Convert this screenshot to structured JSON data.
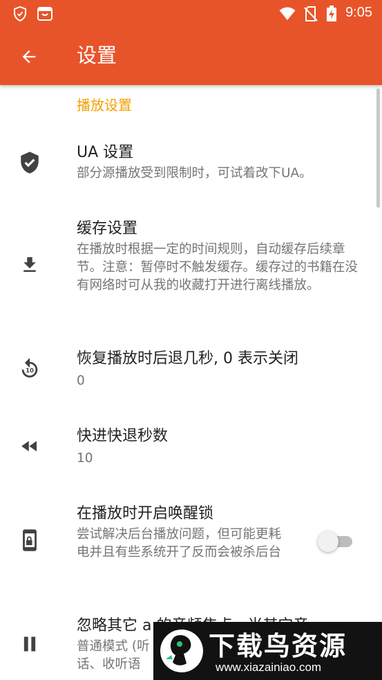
{
  "status_bar": {
    "time": "9:05",
    "left_icons": [
      "shield-check-icon",
      "tv-app-icon"
    ],
    "right_icons": [
      "wifi-icon",
      "no-sim-icon",
      "battery-charging-icon"
    ]
  },
  "toolbar": {
    "title": "设置",
    "back_icon": "arrow-back-icon",
    "color": "#e8542a"
  },
  "section": {
    "title": "播放设置",
    "color": "#f4a000"
  },
  "preferences": [
    {
      "icon": "shield-icon",
      "title": "UA 设置",
      "summary": "部分源播放受到限制时，可试着改下UA。"
    },
    {
      "icon": "download-icon",
      "title": "缓存设置",
      "summary": "在播放时根据一定的时间规则，自动缓存后续章节。注意：暂停时不触发缓存。缓存过的书籍在没有网络时可从我的收藏打开进行离线播放。"
    },
    {
      "icon": "replay-10-icon",
      "title": "恢复播放时后退几秒, 0 表示关闭",
      "summary": "0"
    },
    {
      "icon": "fast-rewind-icon",
      "title": "快进快退秒数",
      "summary": "10"
    },
    {
      "icon": "phone-lock-icon",
      "title": "在播放时开启唤醒锁",
      "summary": "尝试解决后台播放问题，但可能更耗电并且有些系统开了反而会被杀后台",
      "switch_on": false
    },
    {
      "icon": "pause-icon",
      "title": "忽略其它 a     的音频焦点，当其它音",
      "summary": "普通模式 (听",
      "summary_line3": "话、收听语"
    }
  ],
  "watermark": {
    "title": "下载鸟资源",
    "url": "www.xiazainiao.com"
  }
}
